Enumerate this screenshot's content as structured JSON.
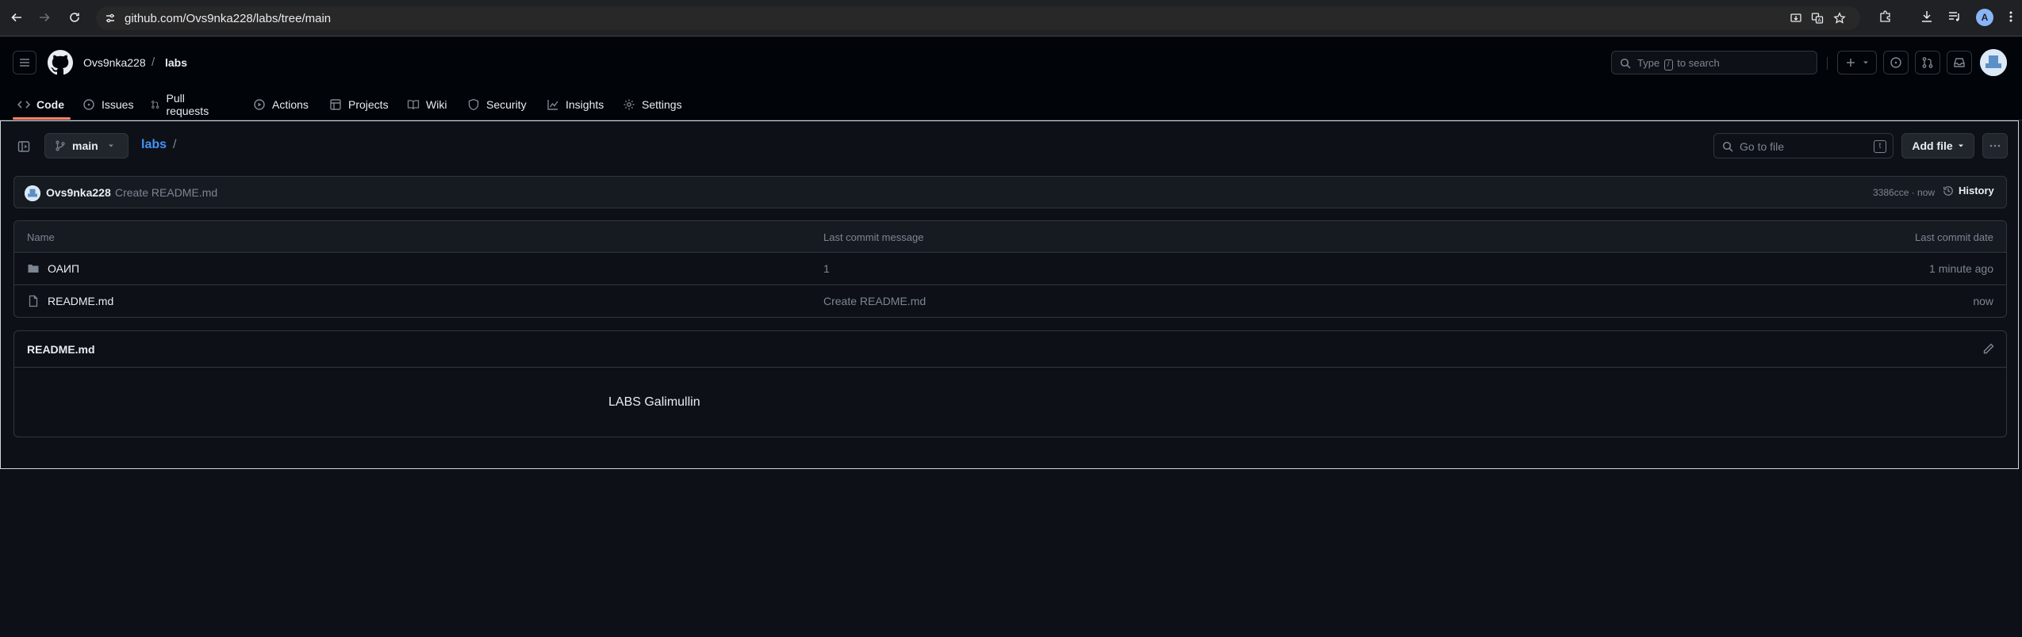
{
  "browser": {
    "url": "github.com/Ovs9nka228/labs/tree/main",
    "profile_initial": "A"
  },
  "header": {
    "owner": "Ovs9nka228",
    "separator": "/",
    "repo": "labs",
    "search_prefix": "Type",
    "search_key": "/",
    "search_suffix": "to search"
  },
  "tabs": [
    {
      "label": "Code",
      "icon": "code-icon",
      "active": true
    },
    {
      "label": "Issues",
      "icon": "issue-icon"
    },
    {
      "label": "Pull requests",
      "icon": "pull-request-icon"
    },
    {
      "label": "Actions",
      "icon": "play-icon"
    },
    {
      "label": "Projects",
      "icon": "table-icon"
    },
    {
      "label": "Wiki",
      "icon": "book-icon"
    },
    {
      "label": "Security",
      "icon": "shield-icon"
    },
    {
      "label": "Insights",
      "icon": "graph-icon"
    },
    {
      "label": "Settings",
      "icon": "gear-icon"
    }
  ],
  "repo_view": {
    "branch": "main",
    "path_repo": "labs",
    "path_slash": "/",
    "goto_placeholder": "Go to file",
    "goto_key": "t",
    "add_file": "Add file"
  },
  "commit": {
    "author": "Ovs9nka228",
    "message": "Create README.md",
    "meta": "3386cce · now",
    "history": "History"
  },
  "files": {
    "columns": [
      "Name",
      "Last commit message",
      "Last commit date"
    ],
    "rows": [
      {
        "name": "ОАИП",
        "type": "folder",
        "message": "1",
        "date": "1 minute ago"
      },
      {
        "name": "README.md",
        "type": "file",
        "message": "Create README.md",
        "date": "now"
      }
    ]
  },
  "readme": {
    "title": "README.md",
    "content": "LABS Galimullin"
  },
  "colors": {
    "accent_underline": "#f78166",
    "link": "#4493f8",
    "bg": "#0d1117"
  }
}
